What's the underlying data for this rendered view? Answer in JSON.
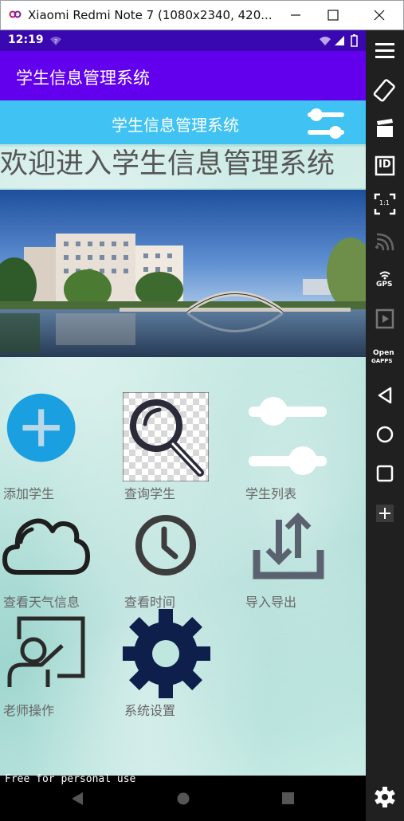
{
  "window": {
    "title": "Xiaomi Redmi Note 7 (1080x2340, 420..."
  },
  "statusbar": {
    "time": "12:19"
  },
  "appbar": {
    "title": "学生信息管理系统"
  },
  "header": {
    "title": "学生信息管理系统"
  },
  "welcome": {
    "text": "欢迎进入学生信息管理系统"
  },
  "menu": {
    "items": [
      {
        "label": "添加学生",
        "icon": "add-icon"
      },
      {
        "label": "查询学生",
        "icon": "search-icon"
      },
      {
        "label": "学生列表",
        "icon": "sliders-icon"
      },
      {
        "label": "查看天气信息",
        "icon": "cloud-icon"
      },
      {
        "label": "查看时间",
        "icon": "clock-icon"
      },
      {
        "label": "导入导出",
        "icon": "import-export-icon"
      },
      {
        "label": "老师操作",
        "icon": "teacher-board-icon"
      },
      {
        "label": "系统设置",
        "icon": "gear-icon"
      }
    ]
  },
  "sidebar": {
    "buttons": [
      "menu-icon",
      "rotate-icon",
      "clapperboard-icon",
      "id-icon",
      "scale-icon",
      "cast-icon",
      "gps-icon",
      "film-icon",
      "opengapps-icon",
      "back-icon",
      "home-icon",
      "overview-icon",
      "plus-icon",
      "settings-icon"
    ],
    "gps_label": "GPS",
    "id_label": "ID",
    "scale_label": "1:1",
    "gapps_label_1": "Open",
    "gapps_label_2": "GAPPS"
  },
  "watermark": "Free for personal use",
  "colors": {
    "statusbar": "#3a08b0",
    "appbar": "#6200ee",
    "header": "#40c2f2",
    "add_circle": "#1aa0e0",
    "gear": "#0d1f4a"
  }
}
